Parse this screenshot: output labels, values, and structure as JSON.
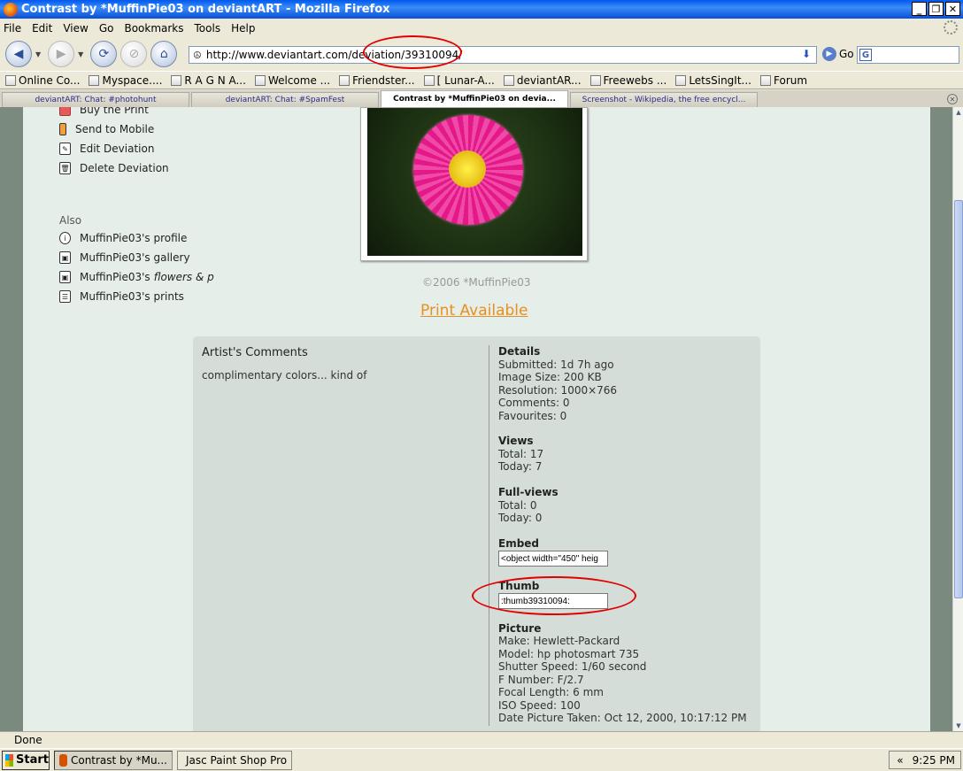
{
  "window": {
    "title": "Contrast by *MuffinPie03 on deviantART - Mozilla Firefox",
    "buttons": [
      "_",
      "❐",
      "✕"
    ]
  },
  "menu": [
    "File",
    "Edit",
    "View",
    "Go",
    "Bookmarks",
    "Tools",
    "Help"
  ],
  "toolbar": {
    "url": "http://www.deviantart.com/deviation/39310094/",
    "go_label": "Go"
  },
  "bookmarks": [
    "Online Co...",
    "Myspace....",
    "R A G N A...",
    "Welcome ...",
    "Friendster...",
    "[ Lunar-A...",
    "deviantAR...",
    "Freewebs ...",
    "LetsSingIt...",
    "Forum"
  ],
  "tabs": [
    "deviantART: Chat: #photohunt",
    "deviantART: Chat: #SpamFest",
    "Contrast by *MuffinPie03 on devia...",
    "Screenshot - Wikipedia, the free encycl..."
  ],
  "sidebar": {
    "actions": [
      "Buy the Print",
      "Send to Mobile",
      "Edit Deviation",
      "Delete Deviation"
    ],
    "also_label": "Also",
    "also_items": [
      "MuffinPie03's profile",
      "MuffinPie03's gallery",
      "MuffinPie03's",
      "MuffinPie03's prints"
    ],
    "gallery_folder": "flowers & p"
  },
  "image": {
    "copyright": "©2006 *MuffinPie03",
    "print_link": "Print Available"
  },
  "comments": {
    "heading": "Artist's Comments",
    "text": "complimentary colors... kind of"
  },
  "details": {
    "heading": "Details",
    "submitted": "Submitted: 1d 7h ago",
    "image_size": "Image Size: 200 KB",
    "resolution": "Resolution: 1000×766",
    "comments": "Comments: 0",
    "favourites": "Favourites: 0",
    "views_heading": "Views",
    "views_total": "Total: 17",
    "views_today": "Today: 7",
    "fullviews_heading": "Full-views",
    "fullviews_total": "Total: 0",
    "fullviews_today": "Today: 0",
    "embed_heading": "Embed",
    "embed_value": "<object width=\"450\" heig",
    "thumb_heading": "Thumb",
    "thumb_value": ":thumb39310094:",
    "picture_heading": "Picture",
    "make": "Make: Hewlett-Packard",
    "model": "Model: hp photosmart 735",
    "shutter": "Shutter Speed: 1/60 second",
    "fnumber": "F Number: F/2.7",
    "focal": "Focal Length: 6 mm",
    "iso": "ISO Speed: 100",
    "date_taken": "Date Picture Taken: Oct 12, 2000, 10:17:12 PM"
  },
  "status": "Done",
  "taskbar": {
    "start": "Start",
    "tasks": [
      "Contrast by *Mu...",
      "Jasc Paint Shop Pro"
    ],
    "tray_arrow": "«",
    "clock": "9:25 PM"
  },
  "icons": {
    "back": "back-icon",
    "forward": "forward-icon",
    "reload": "reload-icon",
    "stop": "stop-icon",
    "home": "home-icon"
  },
  "colors": {
    "print_link": "#e88f1f",
    "annotation": "#e20000",
    "page_bg": "#e5eee8"
  }
}
